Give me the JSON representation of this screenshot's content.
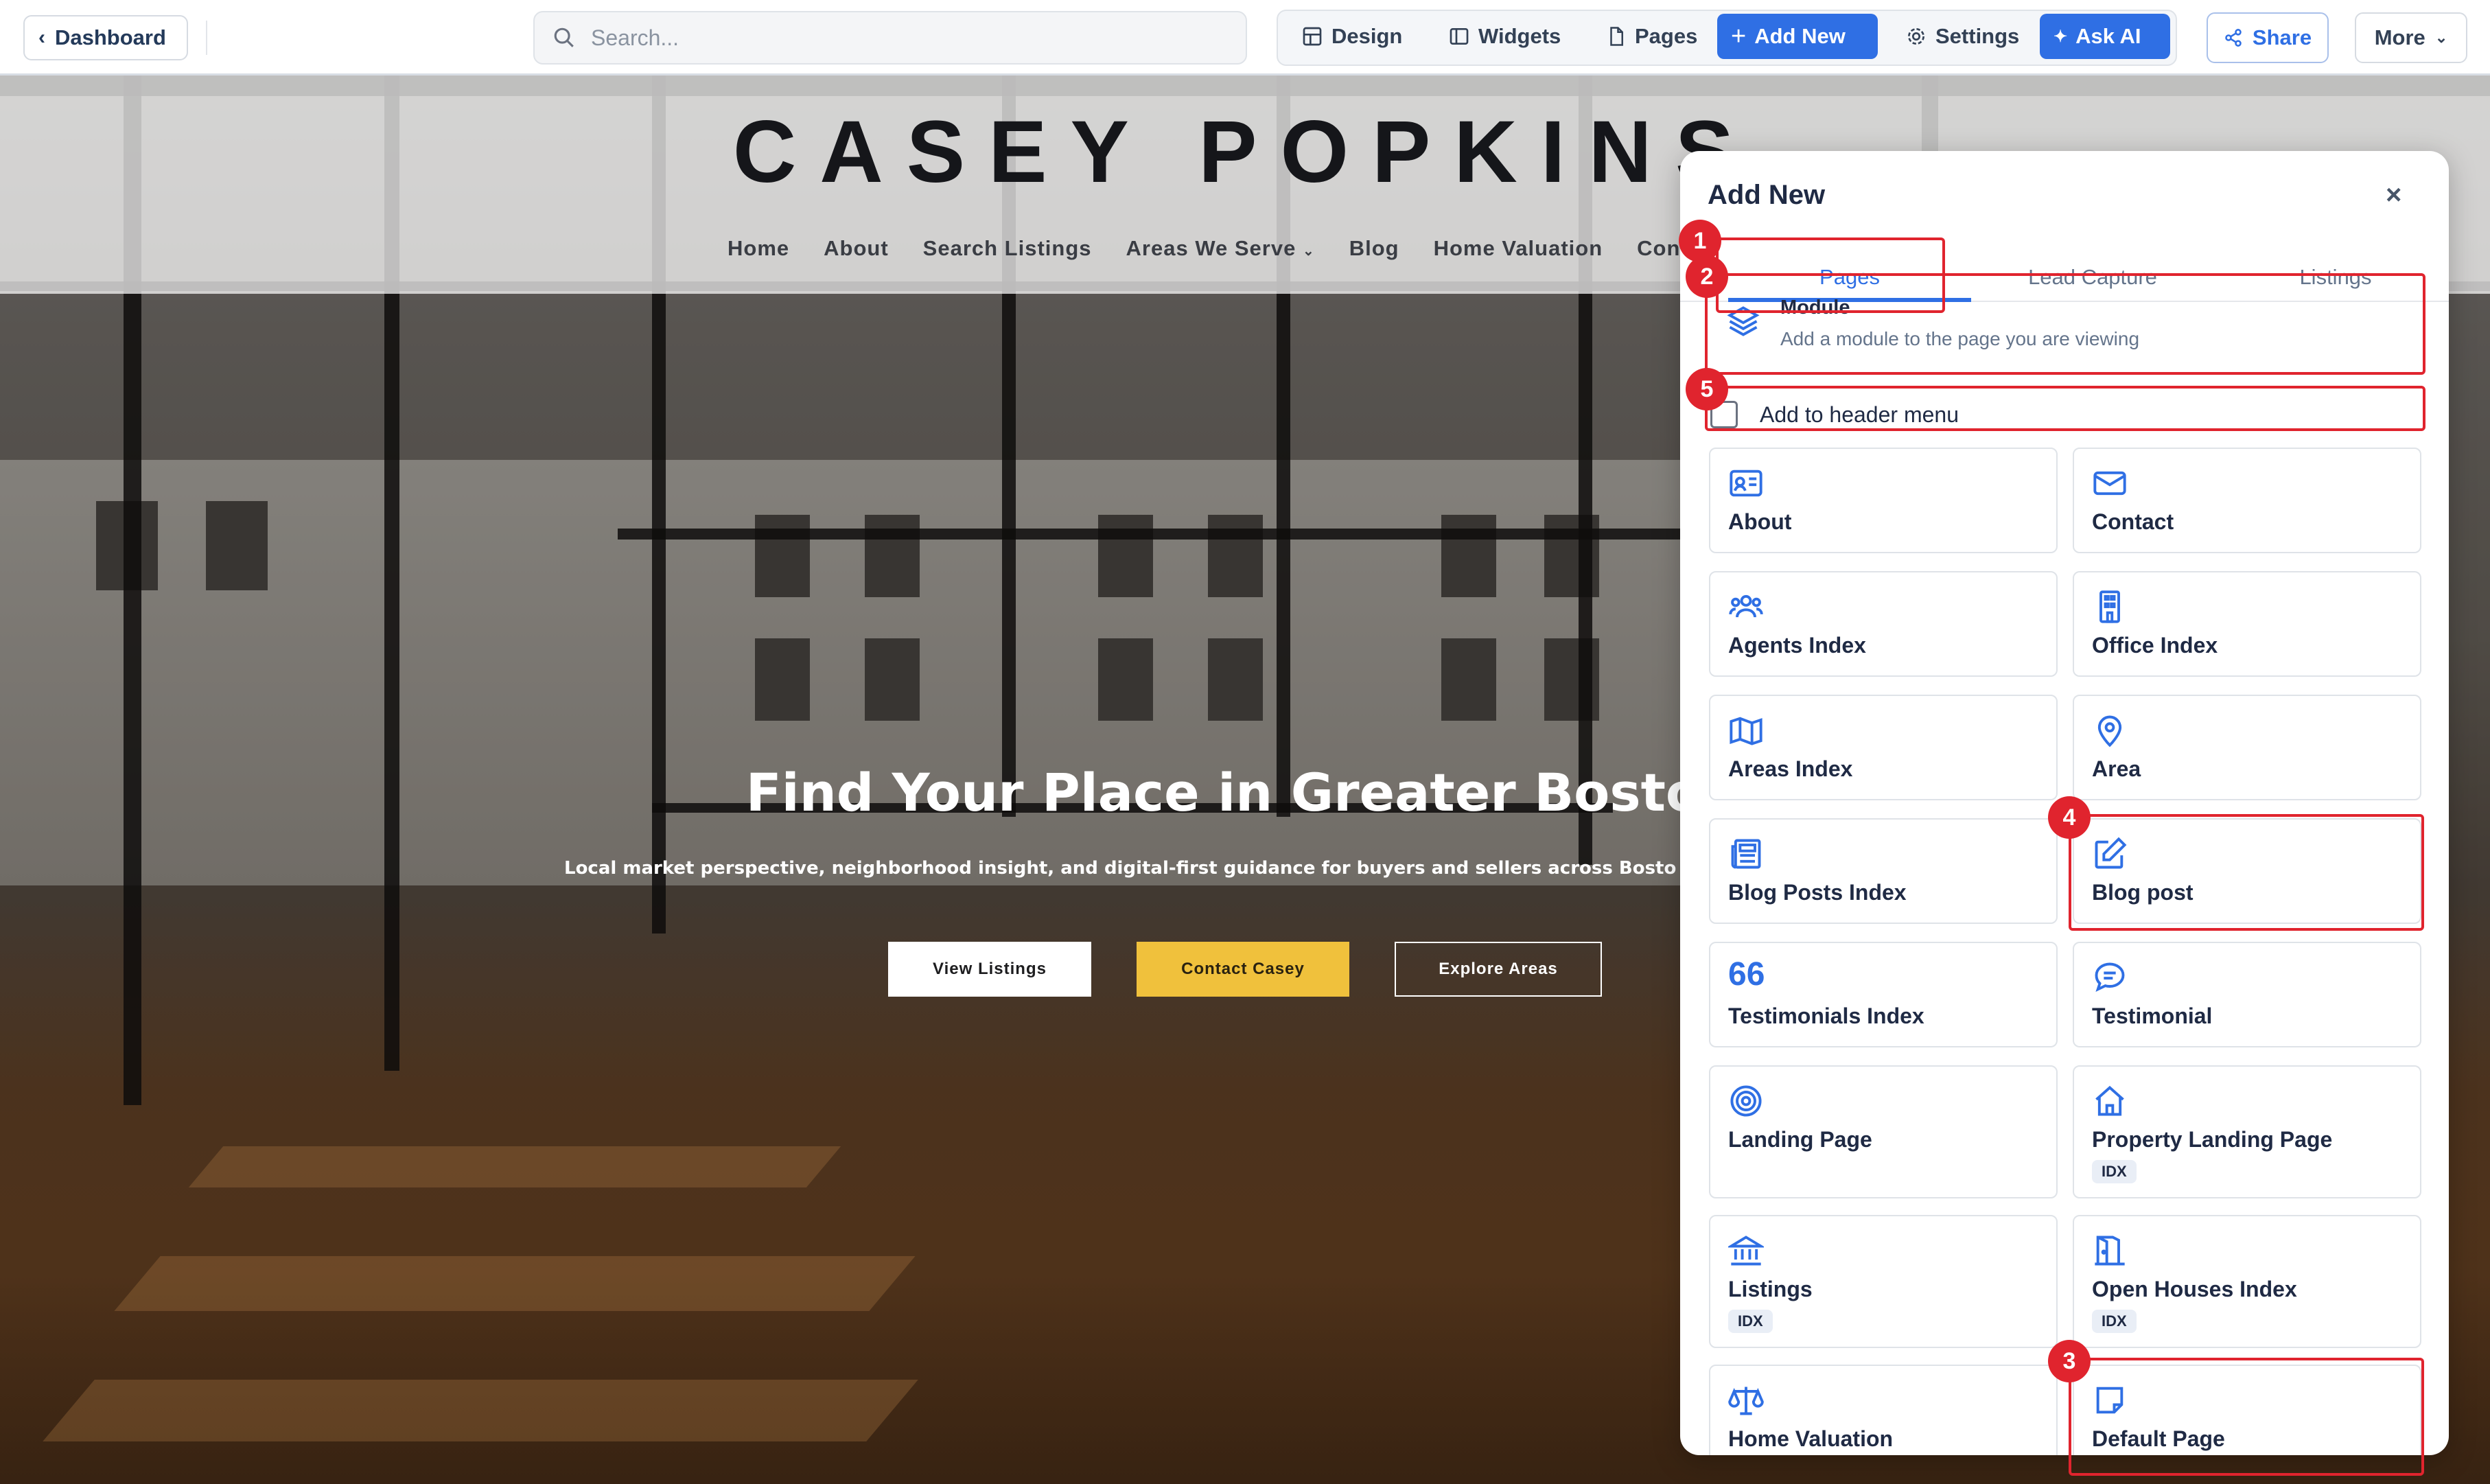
{
  "toolbar": {
    "dashboard_label": "Dashboard",
    "search_placeholder": "Search...",
    "design_label": "Design",
    "widgets_label": "Widgets",
    "pages_label": "Pages",
    "add_new_label": "Add New",
    "settings_label": "Settings",
    "ask_ai_label": "Ask AI",
    "share_label": "Share",
    "more_label": "More"
  },
  "site": {
    "logo": "CASEY POPKINS",
    "nav": [
      "Home",
      "About",
      "Search Listings",
      "Areas We Serve",
      "Blog",
      "Home Valuation",
      "Contact"
    ],
    "hero_title": "Find Your Place in Greater Boston",
    "hero_subtitle": "Local market perspective, neighborhood insight, and digital-first guidance for buyers and sellers across Boston, Cambridge,",
    "cta_listings": "View Listings",
    "cta_contact": "Contact Casey",
    "cta_areas": "Explore Areas"
  },
  "panel": {
    "title": "Add New",
    "close": "×",
    "tabs": [
      "Pages",
      "Lead Capture",
      "Listings"
    ],
    "module_title": "Module",
    "module_desc": "Add a module to the page you are viewing",
    "header_menu_label": "Add to header menu",
    "cards": [
      {
        "label": "About",
        "icon": "id-card-icon"
      },
      {
        "label": "Contact",
        "icon": "envelope-icon"
      },
      {
        "label": "Agents Index",
        "icon": "users-icon"
      },
      {
        "label": "Office Index",
        "icon": "building-icon"
      },
      {
        "label": "Areas Index",
        "icon": "map-icon"
      },
      {
        "label": "Area",
        "icon": "map-pin-icon"
      },
      {
        "label": "Blog Posts Index",
        "icon": "newspaper-icon"
      },
      {
        "label": "Blog post",
        "icon": "edit-icon"
      },
      {
        "label": "Testimonials Index",
        "icon": "quote-icon"
      },
      {
        "label": "Testimonial",
        "icon": "chat-bubble-icon"
      },
      {
        "label": "Landing Page",
        "icon": "target-icon"
      },
      {
        "label": "Property Landing Page",
        "icon": "home-icon",
        "badge": "IDX"
      },
      {
        "label": "Listings",
        "icon": "bank-icon",
        "badge": "IDX"
      },
      {
        "label": "Open Houses Index",
        "icon": "door-icon",
        "badge": "IDX"
      },
      {
        "label": "Home Valuation",
        "icon": "scale-icon"
      },
      {
        "label": "Default Page",
        "icon": "note-icon"
      }
    ]
  },
  "annotations": [
    "1",
    "2",
    "3",
    "4",
    "5"
  ],
  "colors": {
    "accent": "#2f6fe4",
    "annotation": "#e0242e",
    "cta_yellow": "#f0c13c"
  }
}
